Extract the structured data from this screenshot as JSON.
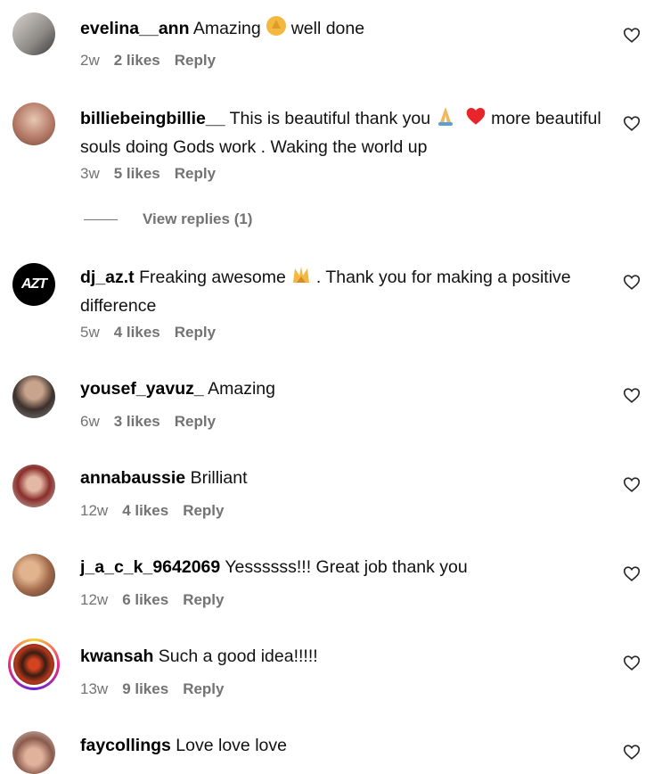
{
  "comments": [
    {
      "username": "evelina__ann",
      "text_before": "Amazing",
      "emoji": "clapping-hands",
      "text_after": "well done",
      "time": "2w",
      "likes": "2 likes",
      "reply": "Reply"
    },
    {
      "username": "billiebeingbillie__",
      "text_before": "This is beautiful thank you",
      "emoji": "folded-hands",
      "emoji2": "red-heart",
      "text_after": "more beautiful souls doing Gods work . Waking the world up",
      "time": "3w",
      "likes": "5 likes",
      "reply": "Reply",
      "view_replies": "View replies (1)"
    },
    {
      "username": "dj_az.t",
      "text_before": "Freaking awesome",
      "emoji": "raising-hands",
      "text_after": ". Thank you for making a positive difference",
      "time": "5w",
      "likes": "4 likes",
      "reply": "Reply",
      "avatar_text": "AZT"
    },
    {
      "username": "yousef_yavuz_",
      "text": "Amazing",
      "time": "6w",
      "likes": "3 likes",
      "reply": "Reply"
    },
    {
      "username": "annabaussie",
      "text": "Brilliant",
      "time": "12w",
      "likes": "4 likes",
      "reply": "Reply"
    },
    {
      "username": "j_a_c_k_9642069",
      "text": "Yessssss!!! Great job thank you",
      "time": "12w",
      "likes": "6 likes",
      "reply": "Reply"
    },
    {
      "username": "kwansah",
      "text": "Such a good idea!!!!!",
      "time": "13w",
      "likes": "9 likes",
      "reply": "Reply"
    },
    {
      "username": "faycollings",
      "text": "Love love love"
    }
  ],
  "colors": {
    "meta": "#737373",
    "heart_stroke": "#262626"
  }
}
